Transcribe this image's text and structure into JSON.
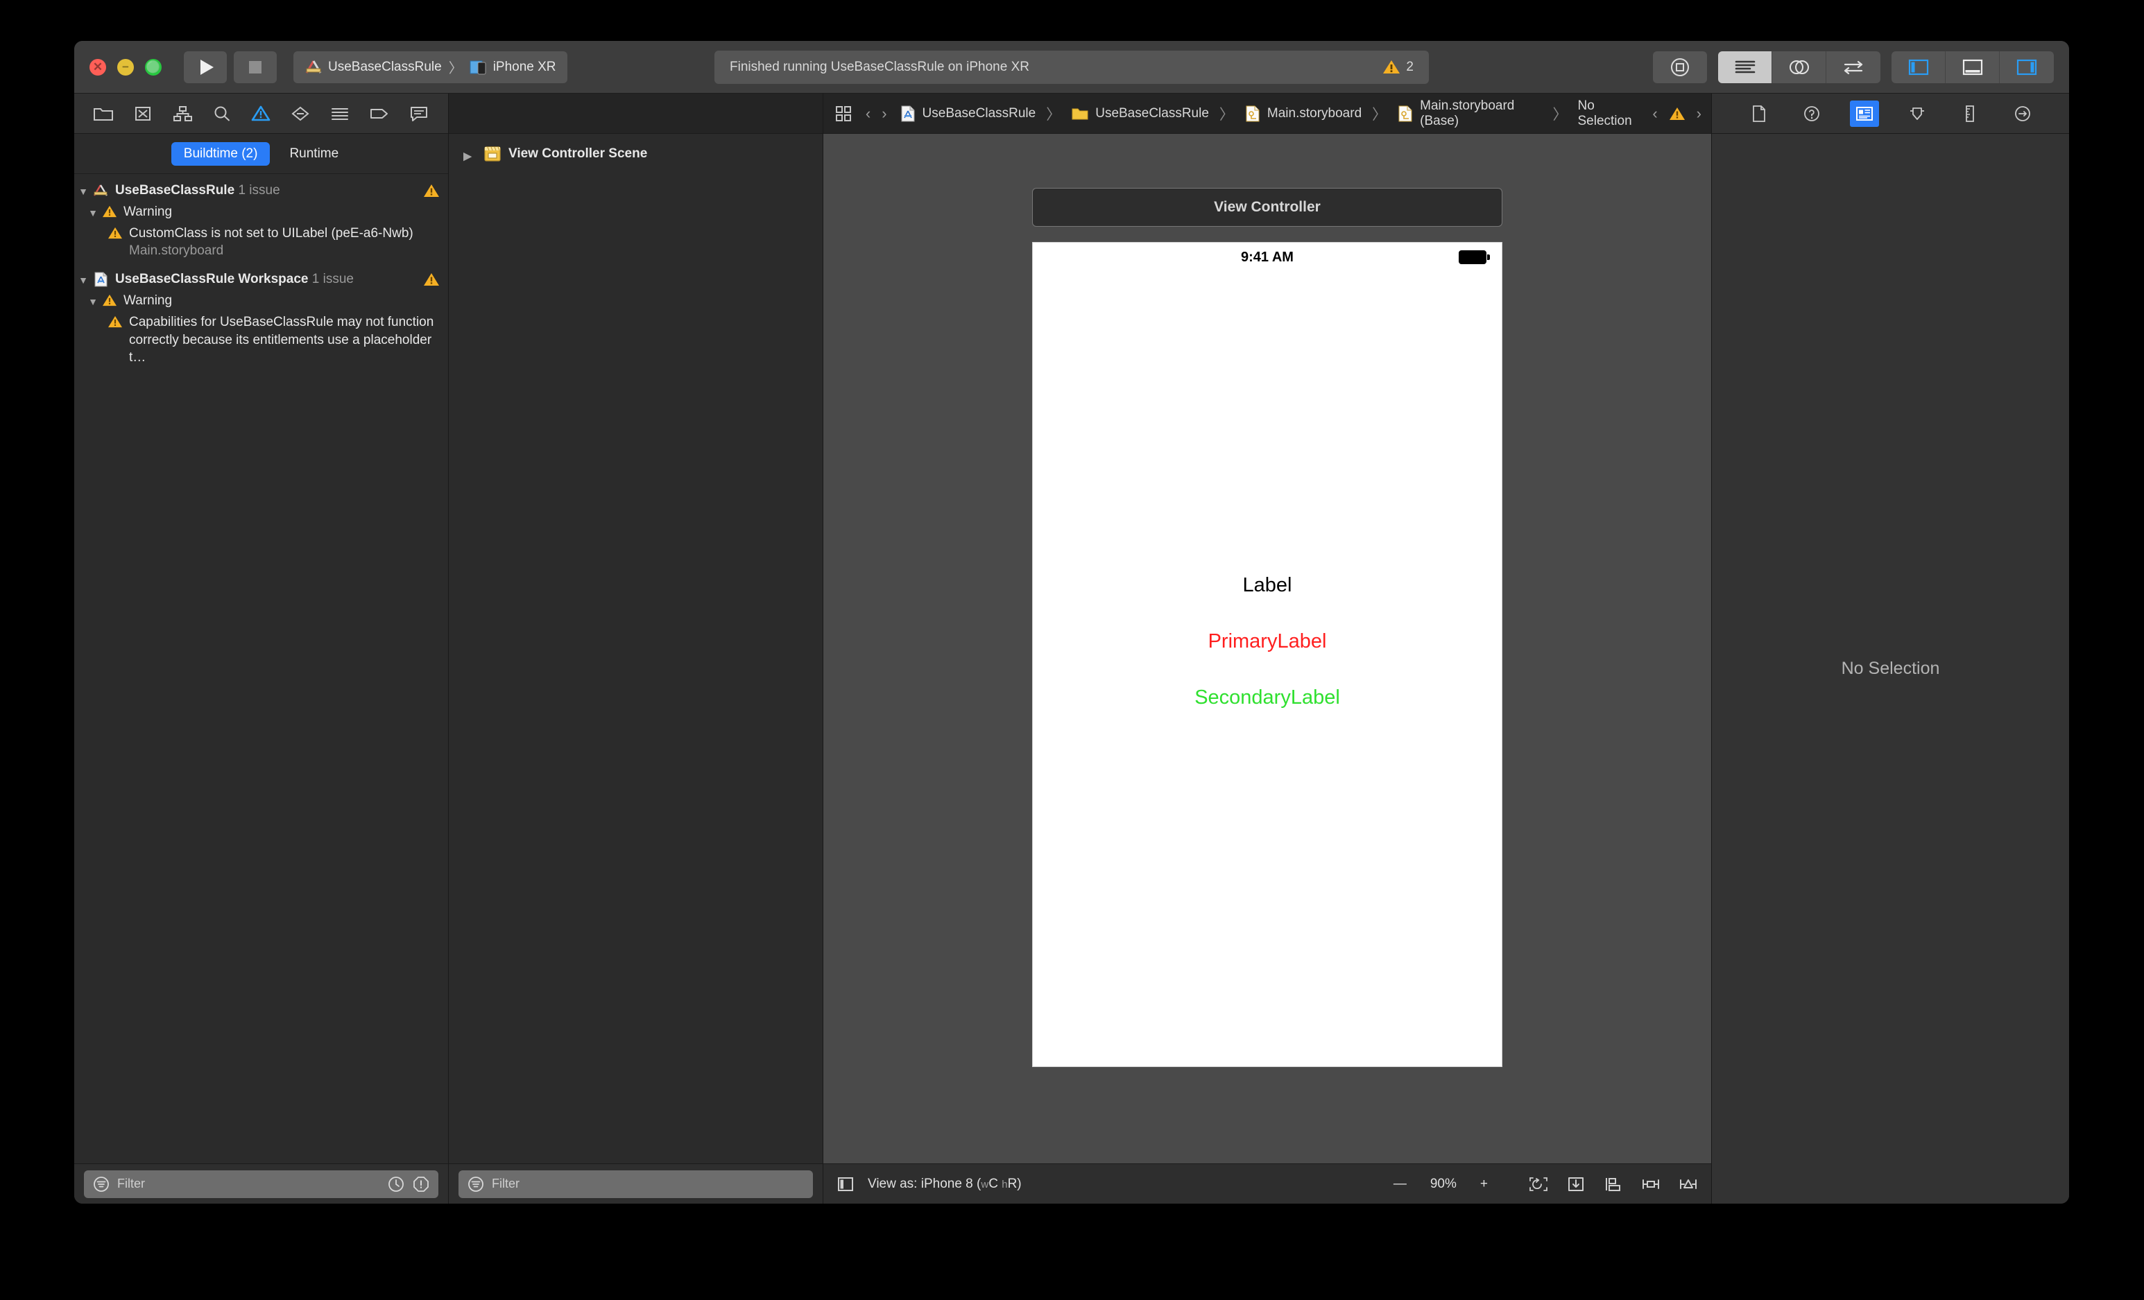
{
  "window": {
    "traffic": {
      "close": "close-button",
      "minimize": "minimize-button",
      "zoom": "zoom-button"
    }
  },
  "toolbar": {
    "run_label": "Run",
    "stop_label": "Stop",
    "scheme": {
      "project": "UseBaseClassRule",
      "destination": "iPhone XR",
      "separator": "〉"
    },
    "status": {
      "message": "Finished running UseBaseClassRule on iPhone XR",
      "warning_count": "2"
    },
    "library_button": "library-button",
    "editor_modes": [
      "standard-editor",
      "assistant-editor",
      "version-editor"
    ],
    "panel_toggles": [
      "navigator-toggle",
      "debug-area-toggle",
      "inspector-toggle"
    ]
  },
  "navigator": {
    "tabs": [
      "project-navigator",
      "source-control-navigator",
      "symbol-navigator",
      "find-navigator",
      "issue-navigator",
      "test-navigator",
      "debug-navigator",
      "breakpoint-navigator",
      "report-navigator"
    ],
    "active_tab": "issue-navigator",
    "scope": {
      "buildtime": "Buildtime (2)",
      "runtime": "Runtime",
      "selected": "Buildtime (2)"
    },
    "groups": [
      {
        "title": "UseBaseClassRule",
        "count": "1 issue",
        "icon": "xcode-project-icon",
        "children": [
          {
            "title": "Warning",
            "icon": "warning-icon",
            "issues": [
              {
                "text": "CustomClass is not set to UILabel (peE-a6-Nwb)",
                "file": "Main.storyboard"
              }
            ]
          }
        ]
      },
      {
        "title": "UseBaseClassRule Workspace",
        "count": "1 issue",
        "icon": "xcode-workspace-icon",
        "children": [
          {
            "title": "Warning",
            "icon": "warning-icon",
            "issues": [
              {
                "text": "Capabilities for UseBaseClassRule may not function correctly because its entitlements use a placeholder t…",
                "file": ""
              }
            ]
          }
        ]
      }
    ],
    "filter": {
      "placeholder": "Filter",
      "value": "",
      "toggles": [
        "recent-filter",
        "errors-filter"
      ]
    }
  },
  "outline": {
    "items": [
      {
        "label": "View Controller Scene",
        "icon": "scene-icon",
        "expanded": false
      }
    ],
    "filter": {
      "placeholder": "Filter",
      "value": ""
    }
  },
  "jumpbar": {
    "related_items": "related-items-icon",
    "back": "‹",
    "forward": "›",
    "crumbs": [
      {
        "label": "UseBaseClassRule",
        "icon": "xcode-workspace-icon"
      },
      {
        "label": "UseBaseClassRule",
        "icon": "folder-icon"
      },
      {
        "label": "Main.storyboard",
        "icon": "storyboard-icon"
      },
      {
        "label": "Main.storyboard (Base)",
        "icon": "storyboard-icon"
      },
      {
        "label": "No Selection",
        "icon": ""
      }
    ],
    "separator": "〉",
    "issue_count": ""
  },
  "canvas": {
    "scene_title": "View Controller",
    "device": {
      "status_time": "9:41 AM",
      "battery": "battery-icon"
    },
    "labels": [
      {
        "text": "Label",
        "color": "#000000"
      },
      {
        "text": "PrimaryLabel",
        "color": "#ff1f1f"
      },
      {
        "text": "SecondaryLabel",
        "color": "#2fe02f"
      }
    ],
    "entry_point": "storyboard-entry-point-arrow",
    "bottombar": {
      "outline_toggle": "document-outline-toggle",
      "view_as_prefix": "View as: iPhone 8 (",
      "view_as_w": "w",
      "view_as_wc": "C",
      "view_as_h": "h",
      "view_as_hr": "R",
      "view_as_suffix": ")",
      "zoom_out": "—",
      "zoom_level": "90%",
      "zoom_in": "+",
      "ib_tools": [
        "update-frames-icon",
        "embed-in-icon",
        "align-icon",
        "add-constraints-icon",
        "resolve-issues-icon"
      ]
    }
  },
  "inspector": {
    "tabs": [
      "file-inspector",
      "quick-help-inspector",
      "identity-inspector",
      "attributes-inspector",
      "size-inspector",
      "connections-inspector"
    ],
    "active_tab": "identity-inspector",
    "empty_message": "No Selection"
  },
  "colors": {
    "accent_blue": "#2a7cf7",
    "warning_yellow": "#f5b024",
    "window_bg": "#2b2b2b",
    "canvas_bg": "#4a4a4a"
  }
}
